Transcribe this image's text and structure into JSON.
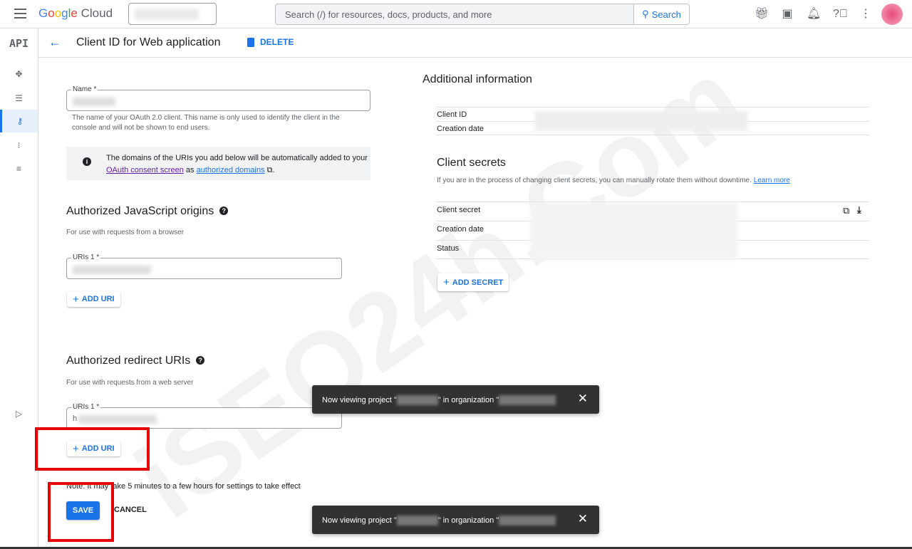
{
  "topbar": {
    "logo": [
      "G",
      "o",
      "o",
      "g",
      "l",
      "e",
      " Cloud"
    ],
    "search_placeholder": "Search (/) for resources, docs, products, and more",
    "search_label": "Search"
  },
  "leftnav": {
    "logo": "API"
  },
  "header": {
    "title": "Client ID for Web application",
    "delete_label": "DELETE"
  },
  "form": {
    "name_label": "Name *",
    "name_hint": "The name of your OAuth 2.0 client. This name is only used to identify the client in the console and will not be shown to end users.",
    "info_text_1": "The domains of the URIs you add below will be automatically added to your ",
    "info_link_1": "OAuth consent screen",
    "info_text_2": " as ",
    "info_link_2": "authorized domains",
    "info_text_3": " ⧉.",
    "js_origins_title": "Authorized JavaScript origins",
    "js_origins_hint": "For use with requests from a browser",
    "uri_label": "URIs 1 *",
    "add_uri": "ADD URI",
    "redirect_title": "Authorized redirect URIs",
    "redirect_hint": "For use with requests from a web server",
    "redirect_value_prefix": "h",
    "note": "Note: It may take 5 minutes to a few hours for settings to take effect",
    "save": "SAVE",
    "cancel": "CANCEL"
  },
  "additional": {
    "title": "Additional information",
    "rows": [
      "Client ID",
      "Creation date"
    ],
    "secrets_title": "Client secrets",
    "secrets_hint": "If you are in the process of changing client secrets, you can manually rotate them without downtime.",
    "learn_more": "Learn more",
    "secret_rows": [
      "Client secret",
      "Creation date",
      "Status"
    ],
    "add_secret": "ADD SECRET"
  },
  "toasts": [
    {
      "prefix": "Now viewing project \"",
      "middle": "\" in organization \"",
      "close": "✕"
    },
    {
      "prefix": "Now viewing project \"",
      "middle": "\" in organization \"",
      "close": "✕"
    }
  ],
  "watermark": "iSEO24h.Com",
  "colors": {
    "accent": "#1a73e8",
    "highlight": "#e60000",
    "toast": "#323232"
  }
}
